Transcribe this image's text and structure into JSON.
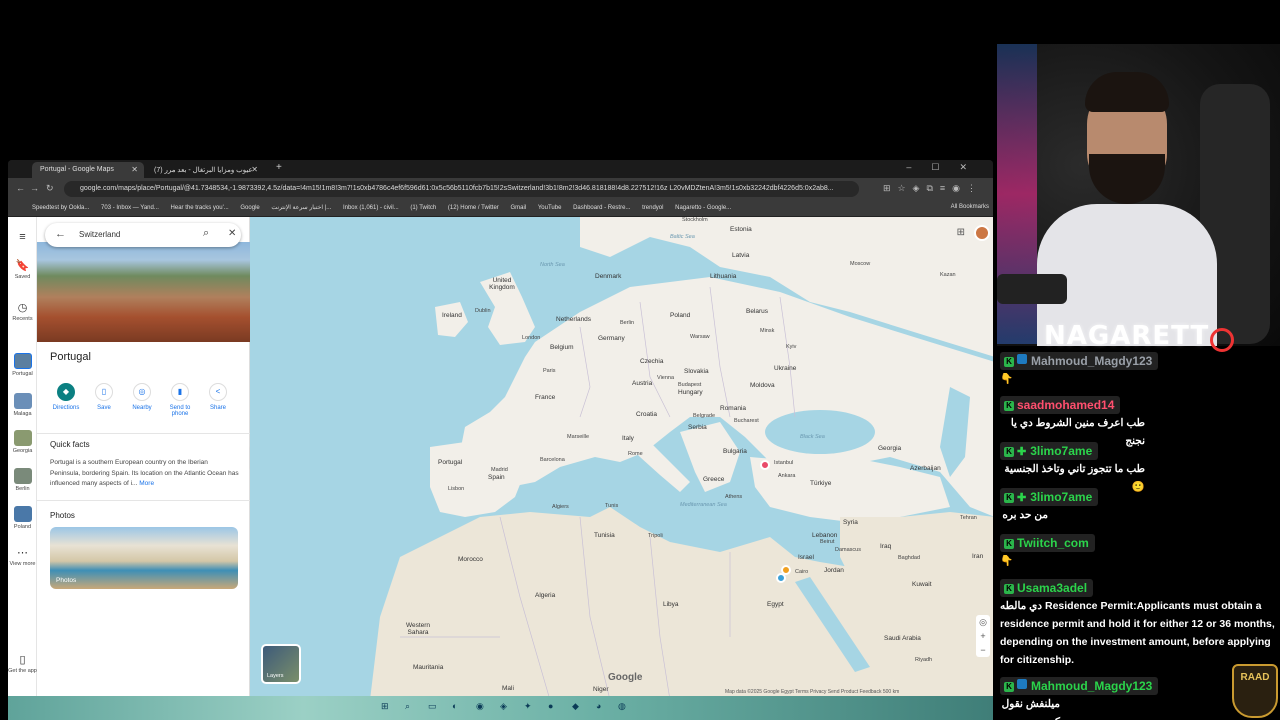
{
  "browser": {
    "tabs": [
      {
        "title": "Portugal - Google Maps",
        "active": true
      },
      {
        "title": "(7) عيوب ومزايا البرتغال - بعد مرر",
        "active": false
      }
    ],
    "url": "google.com/maps/place/Portugal/@41.7348534,-1.9873392,4.5z/data=!4m15!1m8!3m7!1s0xb4786c4ef6f596d61:0x5c56b5110fcb7b15!2sSwitzerland!3b1!8m2!3d46.818188!4d8.227512!16z L20vMDZtenA!3m5!1s0xb32242dbf4226d5:0x2ab8...",
    "bookmarks": [
      "Speedtest by Ookla...",
      "703 - Inbox — Yand...",
      "Hear the tracks you'...",
      "Google",
      "اختبار سرعة الإنترنت |...",
      "Inbox (1,061) - civil...",
      "(1) Twitch",
      "(12) Home / Twitter",
      "Gmail",
      "YouTube",
      "Dashboard - Restre...",
      "trendyol",
      "Nagaretto - Google..."
    ],
    "all_bookmarks": "All Bookmarks"
  },
  "maps": {
    "rail": [
      {
        "icon": "menu-icon",
        "label": ""
      },
      {
        "icon": "bookmark-icon",
        "label": "Saved"
      },
      {
        "icon": "history-icon",
        "label": "Recents"
      },
      {
        "icon": "thumb",
        "label": "Portugal"
      },
      {
        "icon": "thumb",
        "label": "Malaga"
      },
      {
        "icon": "thumb",
        "label": "Georgia"
      },
      {
        "icon": "thumb",
        "label": "Berlin"
      },
      {
        "icon": "thumb",
        "label": "Poland"
      },
      {
        "icon": "more-icon",
        "label": "View more"
      },
      {
        "icon": "phone-icon",
        "label": "Get the app"
      }
    ],
    "search_value": "Switzerland",
    "place_title": "Portugal",
    "actions": [
      "Directions",
      "Save",
      "Nearby",
      "Send to phone",
      "Share"
    ],
    "quick_facts_title": "Quick facts",
    "quick_facts_text": "Portugal is a southern European country on the Iberian Peninsula, bordering Spain. Its location on the Atlantic Ocean has influenced many aspects of i...",
    "more_label": "More",
    "photos_title": "Photos",
    "photos_label": "Photos",
    "layers_label": "Layers",
    "google_mark": "Google",
    "map_footer": "Map data ©2025 Google   Egypt   Terms   Privacy   Send Product Feedback   500 km"
  },
  "map_labels": {
    "countries": [
      "Estonia",
      "Latvia",
      "Lithuania",
      "Denmark",
      "United Kingdom",
      "Ireland",
      "Netherlands",
      "Poland",
      "Belarus",
      "Belgium",
      "Germany",
      "Czechia",
      "Slovakia",
      "Ukraine",
      "France",
      "Austria",
      "Hungary",
      "Moldova",
      "Romania",
      "Croatia",
      "Serbia",
      "Italy",
      "Bulgaria",
      "Portugal",
      "Spain",
      "Greece",
      "Türkiye",
      "Georgia",
      "Azerbaijan",
      "Syria",
      "Tunisia",
      "Lebanon",
      "Iraq",
      "Israel",
      "Jordan",
      "Morocco",
      "Algeria",
      "Libya",
      "Egypt",
      "Kuwait",
      "Iran",
      "Saudi Arabia",
      "Western Sahara",
      "Mauritania",
      "Mali",
      "Niger"
    ],
    "seas": [
      "North Sea",
      "Baltic Sea",
      "Black Sea",
      "Mediterranean Sea"
    ],
    "cities": [
      "Dublin",
      "London",
      "Paris",
      "Berlin",
      "Warsaw",
      "Kyiv",
      "Minsk",
      "Vienna",
      "Budapest",
      "Bucharest",
      "Belgrade",
      "Rome",
      "Marseille",
      "Barcelona",
      "Madrid",
      "Lisbon",
      "Istanbul",
      "Ankara",
      "Athens",
      "Algiers",
      "Tunis",
      "Cairo",
      "Tripoli",
      "Beirut",
      "Damascus",
      "Baghdad",
      "Tehran",
      "Riyadh",
      "Kazan",
      "Stockholm",
      "Moscow"
    ]
  },
  "stream": {
    "streamer_name": "NAGARETT",
    "logo_text": "RAAD"
  },
  "chat": [
    {
      "user": "Mahmoud_Magdy123",
      "color": "#9aa0a8",
      "text": "👇",
      "rtl": false
    },
    {
      "user": "saadmohamed14",
      "color": "#ff4f6e",
      "text": "طب اعرف منين الشروط دي يا نجنج",
      "rtl": true
    },
    {
      "user": "3limo7ame",
      "color": "#2bd44b",
      "text": "طب ما تتجوز تاني وتاخذ الجنسية 🙂",
      "rtl": true
    },
    {
      "user": "3limo7ame",
      "color": "#2bd44b",
      "text": "من حد بره",
      "rtl": true
    },
    {
      "user": "Twiitch_com",
      "color": "#2bd44b",
      "text": "👇",
      "rtl": false
    },
    {
      "user": "Usama3adel",
      "color": "#2bd44b",
      "text": "دي مالطه Residence Permit:Applicants must obtain a residence permit and hold it for either 12 or 36 months, depending on the investment amount, before applying for citizenship.",
      "rtl": false
    },
    {
      "user": "Mahmoud_Magdy123",
      "color": "#2bd44b",
      "text": "ميلنفش نقول كده",
      "rtl": true
    }
  ],
  "colors": {
    "water": "#a6d5e4",
    "land": "#f2efe9",
    "maps_accent": "#1a73e8",
    "directions": "#0b8082"
  }
}
